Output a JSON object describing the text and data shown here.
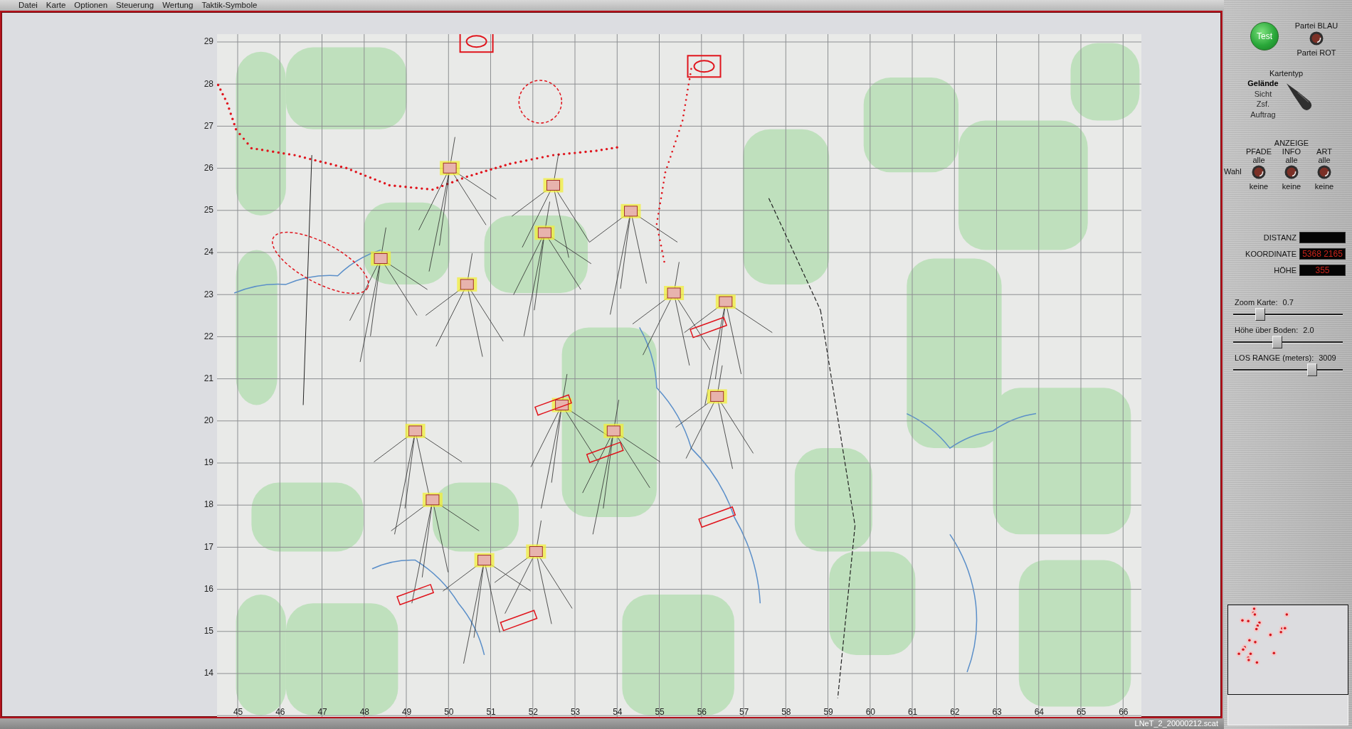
{
  "menu": [
    "Datei",
    "Karte",
    "Optionen",
    "Steuerung",
    "Wertung",
    "Taktik-Symbole"
  ],
  "map": {
    "y_ticks": [
      "29",
      "28",
      "27",
      "26",
      "25",
      "24",
      "23",
      "22",
      "21",
      "20",
      "19",
      "18",
      "17",
      "16",
      "15",
      "14"
    ],
    "x_ticks": [
      "45",
      "46",
      "47",
      "48",
      "49",
      "50",
      "51",
      "52",
      "53",
      "54",
      "55",
      "56",
      "57",
      "58",
      "59",
      "60",
      "61",
      "62",
      "63",
      "64",
      "65",
      "66"
    ]
  },
  "side_panel": {
    "test_button": {
      "label": "Test"
    },
    "party_switch": {
      "top_label": "Partei BLAU",
      "bottom_label": "Partei ROT"
    },
    "map_type": {
      "title": "Kartentyp",
      "options": [
        {
          "label": "Gelände",
          "selected": true
        },
        {
          "label": "Sicht",
          "selected": false
        },
        {
          "label": "Zsf.",
          "selected": false
        },
        {
          "label": "Auftrag",
          "selected": false
        }
      ]
    },
    "display": {
      "title": "ANZEIGE",
      "row_label": "Wahl",
      "switches": [
        {
          "label": "PFADE",
          "top": "alle",
          "bottom": "keine"
        },
        {
          "label": "INFO",
          "top": "alle",
          "bottom": "keine"
        },
        {
          "label": "ART",
          "top": "alle",
          "bottom": "keine"
        }
      ]
    },
    "readouts": [
      {
        "label": "DISTANZ"
      },
      {
        "label": "KOORDINATE",
        "value": "5368 2165"
      },
      {
        "label": "HÖHE",
        "value": "355"
      }
    ],
    "sliders": [
      {
        "label": "Zoom Karte:",
        "reading": "0.7",
        "level": 0.22
      },
      {
        "label": "Höhe über Boden:",
        "reading": "2.0",
        "level": 0.39
      },
      {
        "label": "LOS RANGE (meters):",
        "reading": "3009",
        "level": 0.74
      }
    ]
  },
  "status_bar": {
    "file_name": "LNeT_2_20000212.scat"
  }
}
